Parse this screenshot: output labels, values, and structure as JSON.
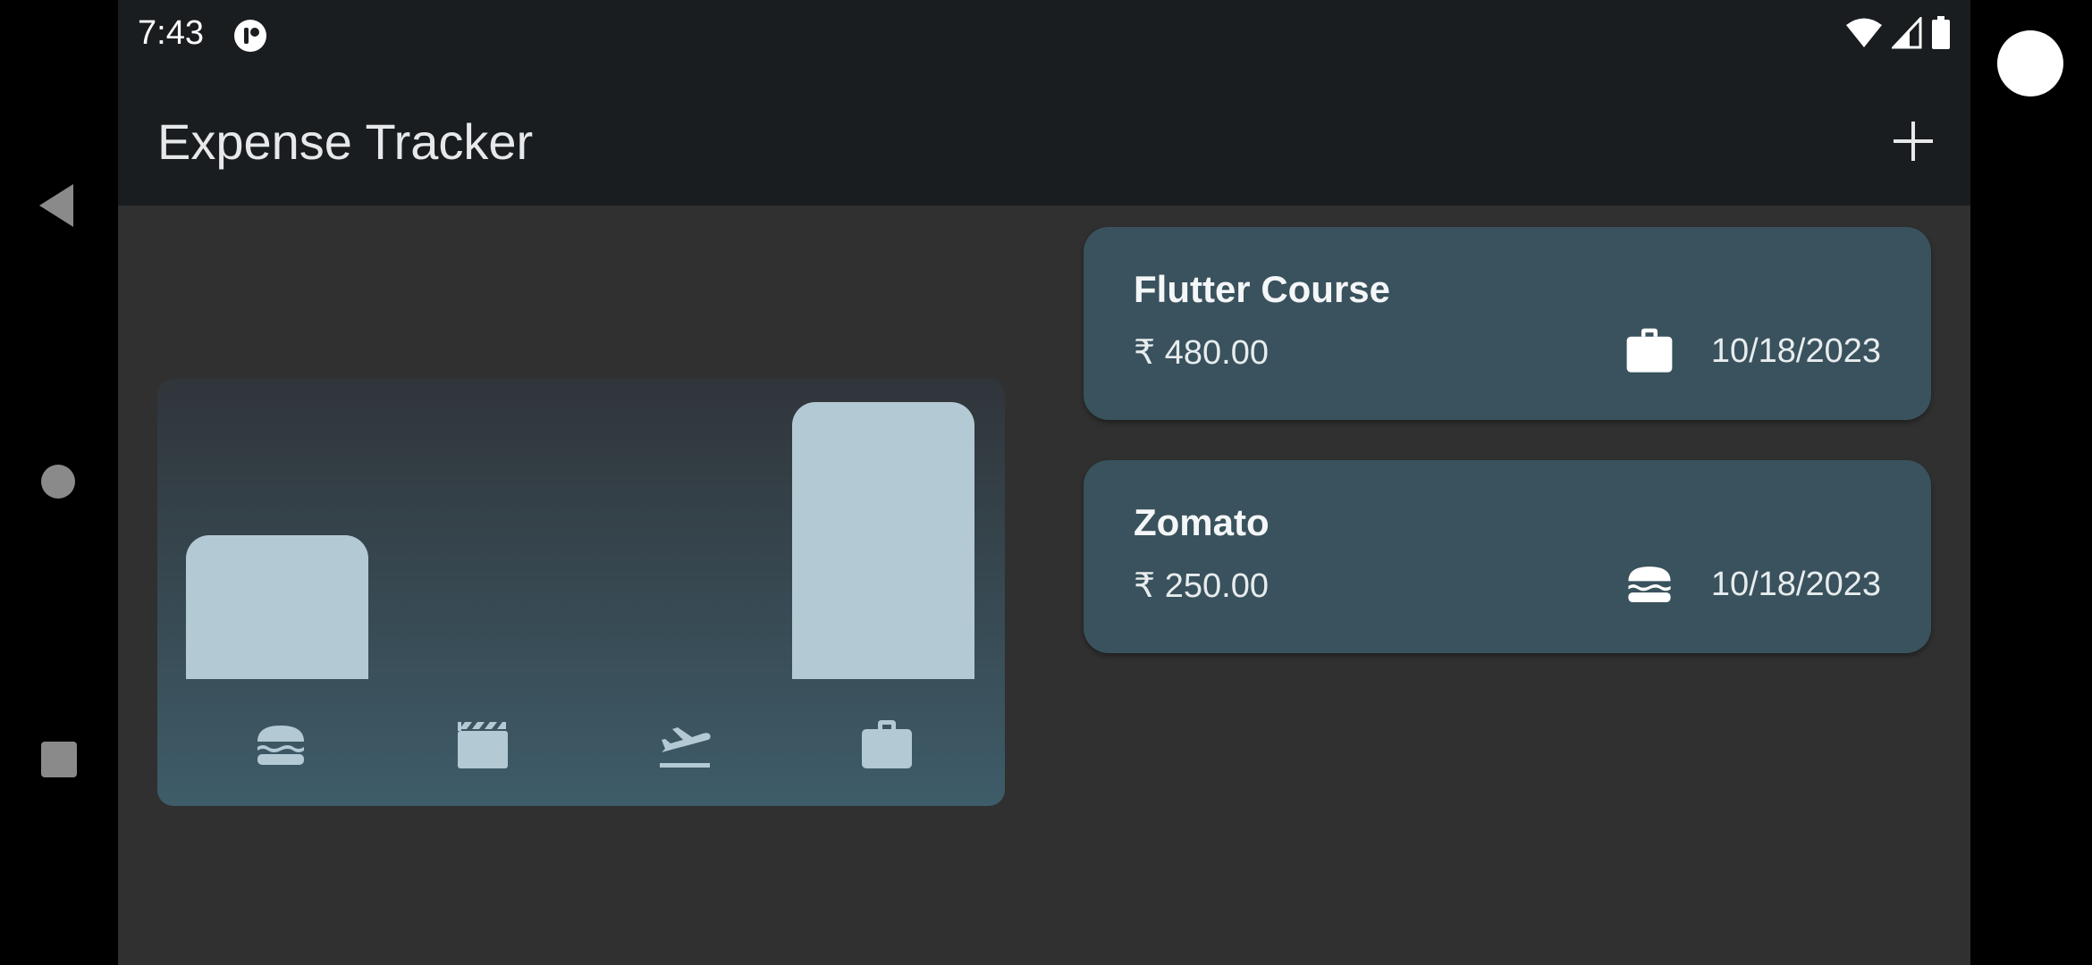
{
  "status_bar": {
    "time": "7:43",
    "app_icon": "notification-app-icon",
    "icons": [
      "wifi-icon",
      "cell-signal-icon",
      "battery-icon"
    ]
  },
  "app_bar": {
    "title": "Expense Tracker",
    "add_icon": "plus-icon"
  },
  "chart_data": {
    "type": "bar",
    "categories": [
      "food",
      "leisure",
      "travel",
      "work"
    ],
    "category_icons": [
      "burger-icon",
      "clapperboard-icon",
      "flight-takeoff-icon",
      "briefcase-icon"
    ],
    "values": [
      250,
      0,
      0,
      480
    ],
    "ylim": [
      0,
      480
    ],
    "bar_color": "#b3c9d3",
    "grid": false,
    "legend": "none"
  },
  "expenses": [
    {
      "title": "Flutter Course",
      "amount": "₹ 480.00",
      "category_icon": "briefcase-icon",
      "date": "10/18/2023"
    },
    {
      "title": "Zomato",
      "amount": "₹ 250.00",
      "category_icon": "burger-icon",
      "date": "10/18/2023"
    }
  ],
  "colors": {
    "background": "#303030",
    "app_bar": "#1a1d20",
    "card": "#39525d",
    "accent": "#b3c9d3"
  },
  "system_nav": {
    "back": "back-triangle-icon",
    "home": "home-circle-icon",
    "recents": "recents-square-icon"
  }
}
